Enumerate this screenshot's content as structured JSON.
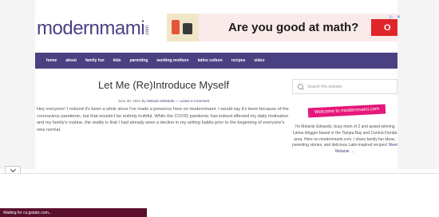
{
  "logo": {
    "text": "modernmami",
    "suffix": ".com"
  },
  "ad": {
    "headline": "Are you good at math?",
    "button_label": "O",
    "info_icon": "ad-info-icon",
    "close_icon": "ad-close-icon"
  },
  "nav": {
    "items": [
      "home",
      "about",
      "family fun",
      "kids",
      "parenting",
      "working mothers",
      "latinx culture",
      "recipes",
      "video"
    ]
  },
  "article": {
    "title": "Let Me (Re)Introduce Myself",
    "date": "June 30, 2021 By",
    "author": "Melanie Edwards",
    "separator": " — ",
    "comment_link": "Leave a Comment",
    "body": "Hey everyone! I noticed it's been a while since I've made a presence here on modernmami. I would say it's been because of the coronavirus pandemic, but that wouldn't be entirely truthful. While the COVID pandemic has indeed affected my daily motivation and my family's routine, the reality is that I had already seen a decline in my writing habits prior to the beginning of everyone's new normal."
  },
  "sidebar": {
    "search_placeholder": "Search this website",
    "badge": "Welcome to modernmami.com",
    "bio": "I'm Melanie Edwards, busy mom of 2 and award-winning Latina blogger based in the Tampa Bay and Central Florida area. Here on modernmami.com, I share family fun ideas, parenting stories, and delicious Latin-inspired recipes!",
    "bio_link": "Meet Melanie →"
  },
  "status": {
    "text": "Waiting for cs.gstatic.com..."
  },
  "colors": {
    "brand": "#4a4183",
    "accent": "#e6177a",
    "status_bar": "#5a0e2b"
  }
}
